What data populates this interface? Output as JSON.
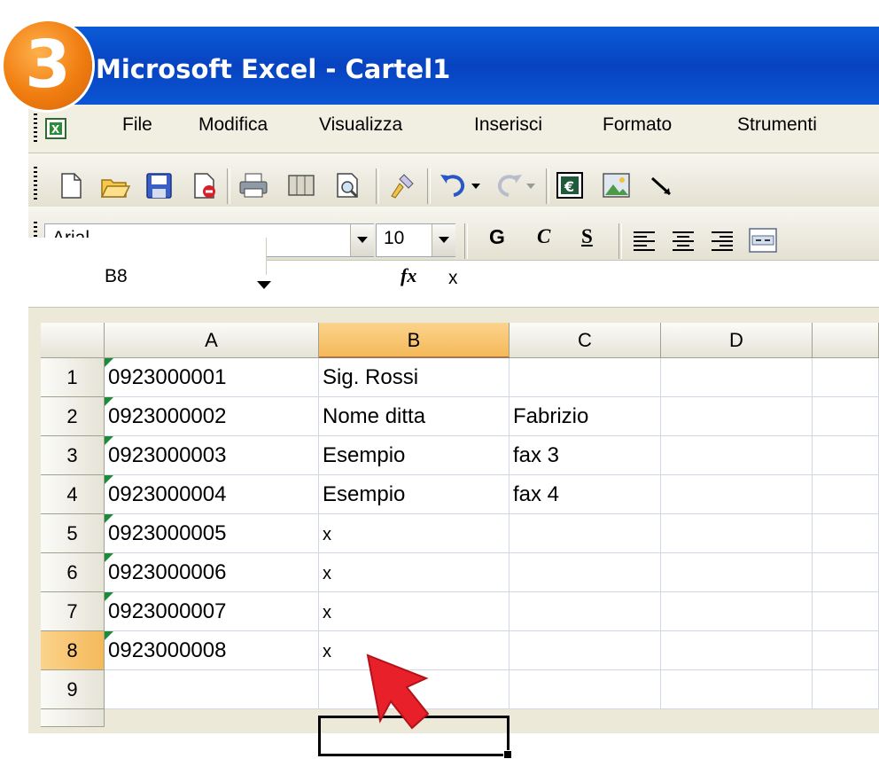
{
  "step_badge": "3",
  "window": {
    "title": "Microsoft Excel - Cartel1"
  },
  "menu": [
    "File",
    "Modifica",
    "Visualizza",
    "Inserisci",
    "Formato",
    "Strumenti"
  ],
  "toolbar_icons": [
    "new-icon",
    "open-icon",
    "save-icon",
    "permission-icon",
    "print-icon",
    "research-icon",
    "print-preview-icon",
    "format-painter-icon",
    "undo-icon",
    "undo-dropdown-icon",
    "redo-icon",
    "redo-dropdown-icon",
    "euro-conversion-icon",
    "insert-picture-icon",
    "drawing-icon"
  ],
  "formatting": {
    "font": "Arial",
    "size": "10",
    "bold": "G",
    "italic": "C",
    "underline": "S",
    "align_icons": [
      "align-left-icon",
      "align-center-icon",
      "align-right-icon",
      "merge-center-icon"
    ]
  },
  "formula_bar": {
    "name_box": "B8",
    "fx_label": "fx",
    "value": "x"
  },
  "columns": [
    "A",
    "B",
    "C",
    "D"
  ],
  "selected_column": "B",
  "selected_row": "8",
  "rows": [
    {
      "n": "1",
      "a": "0923000001",
      "b": "Sig. Rossi",
      "c": ""
    },
    {
      "n": "2",
      "a": "0923000002",
      "b": "Nome ditta",
      "c": "Fabrizio"
    },
    {
      "n": "3",
      "a": "0923000003",
      "b": "Esempio",
      "c": "fax 3"
    },
    {
      "n": "4",
      "a": "0923000004",
      "b": "Esempio",
      "c": "fax 4"
    },
    {
      "n": "5",
      "a": "0923000005",
      "b": "x",
      "c": ""
    },
    {
      "n": "6",
      "a": "0923000006",
      "b": "x",
      "c": ""
    },
    {
      "n": "7",
      "a": "0923000007",
      "b": "x",
      "c": ""
    },
    {
      "n": "8",
      "a": "0923000008",
      "b": "x",
      "c": ""
    },
    {
      "n": "9",
      "a": "",
      "b": "",
      "c": ""
    }
  ],
  "colors": {
    "title_blue": "#0a56d4",
    "badge_orange": "#f07d10",
    "selected_header": "#f5b95a",
    "arrow_red": "#e8202a"
  }
}
